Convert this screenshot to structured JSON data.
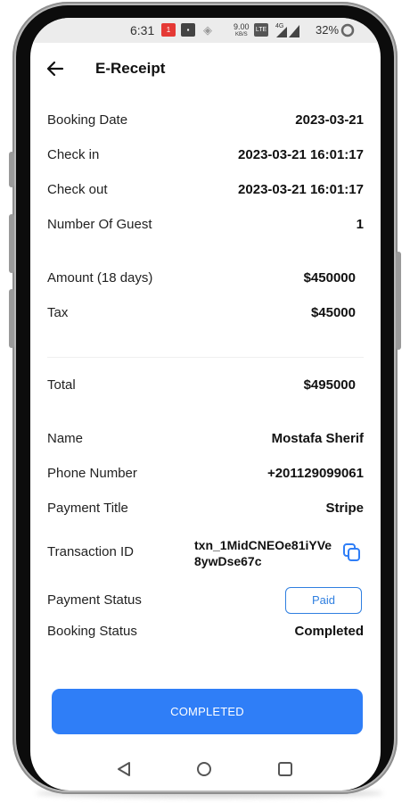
{
  "status_bar": {
    "time": "6:31",
    "net_speed": "9.00",
    "net_unit": "KB/S",
    "network": "4G",
    "battery_percent": "32%"
  },
  "header": {
    "title": "E-Receipt"
  },
  "booking": {
    "booking_date_label": "Booking Date",
    "booking_date_value": "2023-03-21",
    "check_in_label": "Check in",
    "check_in_value": "2023-03-21 16:01:17",
    "check_out_label": "Check out",
    "check_out_value": "2023-03-21 16:01:17",
    "guests_label": "Number Of Guest",
    "guests_value": "1"
  },
  "charges": {
    "amount_label": "Amount (18 days)",
    "amount_value": "$450000",
    "tax_label": "Tax",
    "tax_value": "$45000",
    "total_label": "Total",
    "total_value": "$495000"
  },
  "customer": {
    "name_label": "Name",
    "name_value": "Mostafa Sherif",
    "phone_label": "Phone Number",
    "phone_value": "+201129099061",
    "payment_title_label": "Payment Title",
    "payment_title_value": "Stripe",
    "transaction_label": "Transaction ID",
    "transaction_value": "txn_1MidCNEOe81iYVe8ywDse67c",
    "payment_status_label": "Payment Status",
    "payment_status_value": "Paid",
    "booking_status_label": "Booking Status",
    "booking_status_value": "Completed"
  },
  "action": {
    "button_label": "COMPLETED"
  },
  "colors": {
    "accent": "#2f7ef7",
    "badge_border": "#2f7fe0"
  },
  "icons": {
    "back": "arrow-left-icon",
    "copy": "copy-icon",
    "nav_back": "triangle-back-icon",
    "nav_home": "circle-home-icon",
    "nav_recents": "square-recents-icon"
  }
}
